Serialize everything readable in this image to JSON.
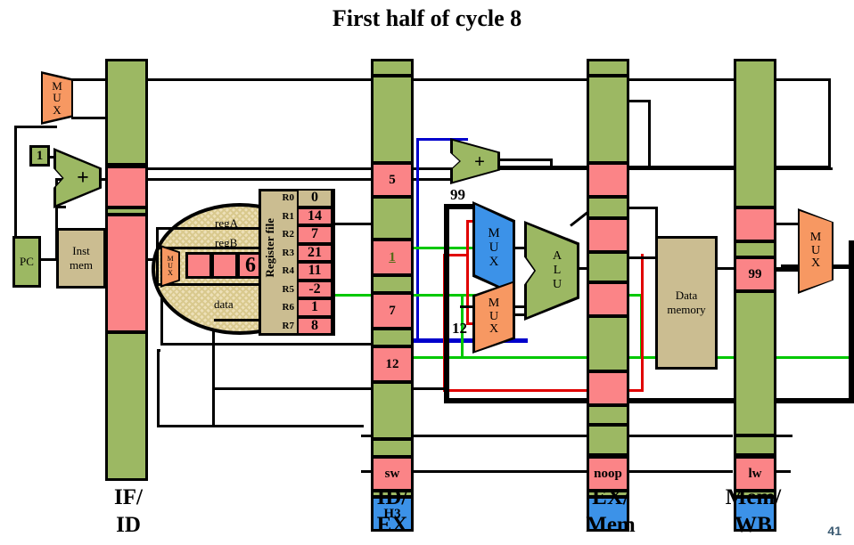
{
  "title": "First half of cycle 8",
  "page_number": "41",
  "stage_labels": [
    {
      "name": "if-id",
      "line1": "IF/",
      "line2": "ID"
    },
    {
      "name": "id-ex",
      "line1": "ID/",
      "line2": "EX"
    },
    {
      "name": "ex-mem",
      "line1": "EX/",
      "line2": "Mem"
    },
    {
      "name": "mem-wb",
      "line1": "Mem/",
      "line2": "WB"
    }
  ],
  "blocks": {
    "pc": "PC",
    "inst_mem_line1": "Inst",
    "inst_mem_line2": "mem",
    "data_mem_line1": "Data",
    "data_mem_line2": "memory",
    "register_file": "Register file",
    "increment_const": "1",
    "adder_if": "+",
    "adder_id": "+",
    "alu": [
      "A",
      "L",
      "U"
    ],
    "mux_glyph": [
      "M",
      "U",
      "X"
    ]
  },
  "register_file_rows": [
    {
      "name": "R0",
      "value": "0"
    },
    {
      "name": "R1",
      "value": "14"
    },
    {
      "name": "R2",
      "value": "7"
    },
    {
      "name": "R3",
      "value": "21"
    },
    {
      "name": "R4",
      "value": "11"
    },
    {
      "name": "R5",
      "value": "-2"
    },
    {
      "name": "R6",
      "value": "1"
    },
    {
      "name": "R7",
      "value": "8"
    }
  ],
  "magnifier": {
    "regA": "regA",
    "regB": "regB",
    "data": "data",
    "write_value": "6"
  },
  "id_ex_values": {
    "pc_plus": "5",
    "regA": "1",
    "regB": "7",
    "offset": "12",
    "instruction": "sw",
    "control": "H3"
  },
  "annotations": {
    "adder_result": "99",
    "forward_offset": "12"
  },
  "ex_mem_values": {
    "instruction": "noop"
  },
  "mem_wb_values": {
    "alu_result": "99",
    "instruction": "lw"
  },
  "colors": {
    "green": "#9cb863",
    "red": "#fb8487",
    "blue": "#3c92e8",
    "tan": "#cbbd91",
    "orange": "#f79862",
    "wire_green": "#00c800",
    "wire_red": "#e00000",
    "wire_blue": "#0000cc",
    "page_number": "#3b5a72"
  }
}
